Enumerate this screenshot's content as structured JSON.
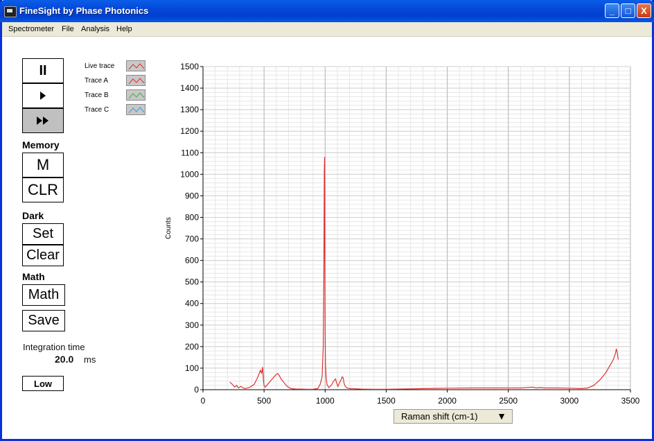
{
  "window": {
    "title": "FineSight by Phase Photonics",
    "minimize_label": "_",
    "maximize_label": "□",
    "close_label": "X"
  },
  "menu": [
    "Spectrometer",
    "File",
    "Analysis",
    "Help"
  ],
  "controls": {
    "pause_label": "II",
    "memory_label": "Memory",
    "m_label": "M",
    "clr_label": "CLR",
    "dark_label": "Dark",
    "set_label": "Set",
    "clear_label": "Clear",
    "math_section_label": "Math",
    "math_label": "Math",
    "save_label": "Save",
    "integration_label": "Integration time",
    "integration_value": "20.0",
    "integration_unit": "ms",
    "gain_label": "Low"
  },
  "legend": [
    {
      "label": "Live trace",
      "color": "#e03030"
    },
    {
      "label": "Trace A",
      "color": "#e03030"
    },
    {
      "label": "Trace B",
      "color": "#3cb043"
    },
    {
      "label": "Trace C",
      "color": "#3a9ad9"
    }
  ],
  "x_axis_selector": "Raman shift (cm-1)",
  "chart_data": {
    "type": "line",
    "ylabel": "Counts",
    "xlabel": "",
    "xlim": [
      0,
      3500
    ],
    "ylim": [
      0,
      1500
    ],
    "x_ticks": [
      0,
      500,
      1000,
      1500,
      2000,
      2500,
      3000,
      3500
    ],
    "y_ticks": [
      0,
      100,
      200,
      300,
      400,
      500,
      600,
      700,
      800,
      900,
      1000,
      1100,
      1200,
      1300,
      1400,
      1500
    ],
    "grid": true,
    "series": [
      {
        "color": "#e03030",
        "x": [
          220,
          240,
          260,
          275,
          290,
          310,
          340,
          380,
          420,
          450,
          470,
          480,
          488,
          495,
          500,
          510,
          530,
          560,
          590,
          610,
          620,
          640,
          660,
          690,
          720,
          760,
          800,
          850,
          900,
          940,
          960,
          975,
          985,
          990,
          993,
          996,
          998,
          1000,
          1003,
          1008,
          1015,
          1030,
          1050,
          1070,
          1085,
          1095,
          1105,
          1115,
          1130,
          1140,
          1148,
          1155,
          1165,
          1180,
          1200,
          1300,
          1400,
          1500,
          1600,
          1700,
          1800,
          2000,
          2200,
          2400,
          2600,
          2700,
          2730,
          2760,
          2800,
          2900,
          3000,
          3100,
          3150,
          3200,
          3250,
          3300,
          3340,
          3360,
          3375,
          3385,
          3392,
          3400
        ],
        "y": [
          35,
          25,
          12,
          20,
          8,
          15,
          5,
          10,
          25,
          60,
          90,
          75,
          105,
          40,
          20,
          12,
          25,
          45,
          65,
          75,
          70,
          50,
          35,
          15,
          5,
          3,
          3,
          2,
          2,
          5,
          25,
          60,
          200,
          560,
          1020,
          1080,
          600,
          280,
          120,
          60,
          25,
          10,
          20,
          40,
          50,
          30,
          15,
          30,
          45,
          60,
          55,
          30,
          15,
          8,
          5,
          3,
          2,
          2,
          3,
          4,
          5,
          7,
          8,
          8,
          8,
          12,
          8,
          10,
          8,
          8,
          7,
          5,
          8,
          20,
          45,
          80,
          120,
          140,
          165,
          190,
          170,
          140
        ]
      }
    ]
  }
}
